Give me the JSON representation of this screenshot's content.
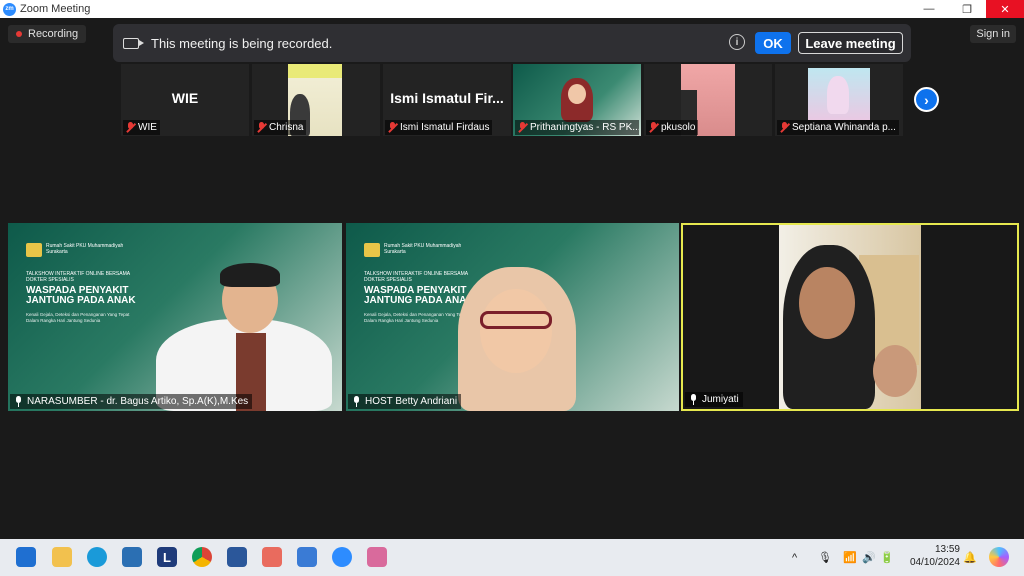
{
  "window": {
    "title": "Zoom Meeting",
    "logo_text": "zm"
  },
  "recording_indicator": {
    "label": "Recording"
  },
  "sign_in": {
    "label": "Sign in"
  },
  "banner": {
    "message": "This meeting is being recorded.",
    "info_glyph": "i",
    "ok_label": "OK",
    "leave_label": "Leave meeting"
  },
  "thumbnails": [
    {
      "big_name": "WIE",
      "label": "WIE"
    },
    {
      "big_name": "",
      "label": "Chrisna"
    },
    {
      "big_name": "Ismi  Ismatul  Fir...",
      "label": "Ismi Ismatul Firdaus"
    },
    {
      "big_name": "",
      "label": "Prithaningtyas - RS PK..."
    },
    {
      "big_name": "",
      "label": "pkusolo"
    },
    {
      "big_name": "",
      "label": "Septiana Whinanda p..."
    }
  ],
  "next_page_glyph": "›",
  "tiles": [
    {
      "label": "NARASUMBER - dr. Bagus Artiko, Sp.A(K),M.Kes"
    },
    {
      "label": "HOST Betty Andriani"
    },
    {
      "label": "Jumiyati"
    }
  ],
  "poster": {
    "brand": "Rumah Sakit PKU Muhammadiyah Surakarta",
    "sub": "TALKSHOW INTERAKTIF ONLINE BERSAMA DOKTER SPESIALIS",
    "headline": "WASPADA PENYAKIT JANTUNG PADA ANAK",
    "small": "Kenali Gejala, Deteksi dan Penanganan Yang Tepat Dalam Rangka Hari Jantung Sedunia"
  },
  "taskbar": {
    "time": "13:59",
    "date": "04/10/2024",
    "caret": "^"
  },
  "colors": {
    "zoom_blue": "#0e72ed",
    "active_speaker_border": "#e6e84f",
    "recording_dot": "#e53935",
    "close_red": "#e81123"
  }
}
